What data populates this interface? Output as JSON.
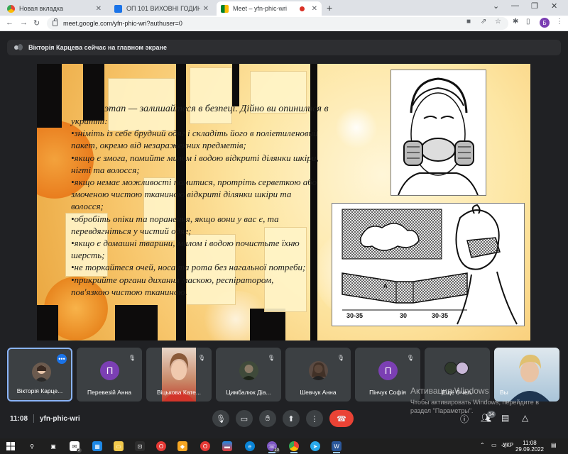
{
  "browser": {
    "tabs": [
      {
        "title": "Новая вкладка",
        "active": false
      },
      {
        "title": "ОП 101 ВИХОВНІ ГОДИНИ",
        "active": false
      },
      {
        "title": "Meet – yfn-phic-wri",
        "active": true
      }
    ],
    "url": "meet.google.com/yfn-phic-wri?authuser=0",
    "profile_initial": "Б",
    "icons": {
      "back": "back-arrow-icon",
      "forward": "forward-arrow-icon",
      "reload": "reload-icon",
      "camera": "camera-icon",
      "share": "share-icon",
      "star": "star-icon",
      "extensions": "puzzle-icon",
      "sidebar": "sidebar-icon",
      "menu": "kebab-menu-icon"
    }
  },
  "presenter": {
    "text": "Вікторія Карцева сейчас на главном экране"
  },
  "slide": {
    "title_line": "этап — залишайтеся в безпеці. Дійно ви опинилися в",
    "lines": [
      "укритті:",
      "•зніміть із себе брудний одяг і складіть його в поліетиленовий",
      "пакет, окремо від незараженних предметів;",
      "•якщо є змога, помийте милом і водою відкриті ділянки шкіри,",
      "нігті та волосся;",
      "•якщо немає можливості помитися, протріть серветкою або",
      "змоченою чистою тканиною відкриті ділянки шкіри та",
      "волосся;",
      "•обробіть опіки та поранення, якщо вони у вас є, та",
      "перевдягніться у чистий одяг;",
      "•якщо є домашні тварини, милом і водою почистьте їхню",
      "шерсть;",
      "•не торкайтеся очей, носа та рота без нагальної потреби;",
      "•прикрийте органи дихання маскою, респіратором,",
      "пов'язкою чистою тканиною."
    ],
    "figure_labels": [
      "30-35",
      "30",
      "30-35",
      "А"
    ]
  },
  "participants": [
    {
      "name": "Вікторія Карцева",
      "display": "Вікторія Карце...",
      "avatar": "photo",
      "color": "#6b5a4e",
      "muted": false,
      "presenting": true
    },
    {
      "name": "Перевезій Анна",
      "display": "Перевезій Анна",
      "avatar": "П",
      "color": "#7b3fb3",
      "muted": true
    },
    {
      "name": "Віцькова Катерина",
      "display": "Віцькова Кате...",
      "avatar": "video",
      "color": "#c9a38a",
      "muted": true
    },
    {
      "name": "Цимбалюк Діана",
      "display": "Цимбалюк Діа...",
      "avatar": "photo",
      "color": "#3f4a3a",
      "muted": true
    },
    {
      "name": "Шевчук Анна",
      "display": "Шевчук Анна",
      "avatar": "photo",
      "color": "#5a4a42",
      "muted": true
    },
    {
      "name": "Пінчук Софія",
      "display": "Пінчук Софія",
      "avatar": "П",
      "color": "#7b3fb3",
      "muted": true
    },
    {
      "name": "Ещё 6 чел.",
      "display": "Ещё 6 чел.",
      "avatar": "group",
      "color": "#5f6368",
      "muted": false
    },
    {
      "name": "Вы",
      "display": "Вы",
      "avatar": "video",
      "color": "#b9d4e6",
      "muted": false
    }
  ],
  "watermark": {
    "line1": "Активация Windows",
    "line2": "Чтобы активировать Windows, перейдите в",
    "line3": "раздел \"Параметры\"."
  },
  "controls": {
    "time": "11:08",
    "meeting_code": "yfn-phic-wri",
    "people_count": "14",
    "buttons": [
      "mic-icon",
      "camera-icon",
      "raise-hand-icon",
      "present-icon",
      "more-options-icon",
      "end-call-icon"
    ],
    "right_icons": [
      "info-icon",
      "people-icon",
      "chat-icon",
      "activities-icon"
    ]
  },
  "taskbar": {
    "language": "УКР",
    "time": "11:08",
    "date": "29.09.2022",
    "badges": {
      "mail": "2",
      "viber": "10"
    }
  },
  "colors": {
    "meet_bg": "#202124",
    "tile_bg": "#3c4043",
    "accent": "#8ab4f8",
    "end_call": "#ea4335",
    "avatar_purple": "#7b3fb3"
  }
}
